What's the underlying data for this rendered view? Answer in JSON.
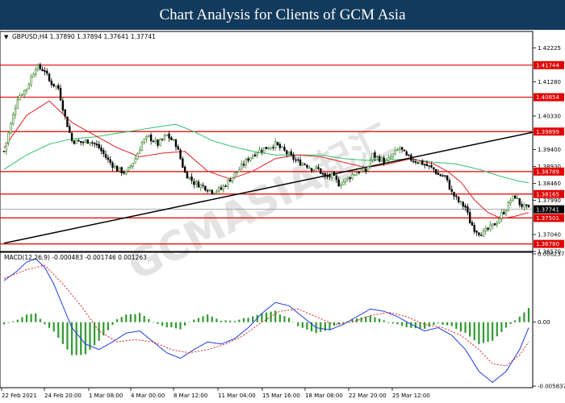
{
  "header": {
    "title": "Chart Analysis for Clients of GCM Asia"
  },
  "colors": {
    "header_bg": "#123a5c",
    "bull_candle": "#2f7d1e",
    "bear_candle": "#000000",
    "ma_fast": "#e02020",
    "ma_slow": "#30c070",
    "level_line": "#e00000",
    "trendline": "#000000",
    "macd_line": "#1f3fe0",
    "signal_line": "#e02020",
    "histogram": "#2f9a2f",
    "price_tag_bg": "#e00000",
    "current_tag_bg": "#000000"
  },
  "chart_data": [
    {
      "type": "candlestick",
      "symbol_info": "GBPUSD,H4  1.37890 1.37894 1.37641 1.37741",
      "ylim": [
        1.3657,
        1.4268
      ],
      "y_ticks": [
        "1.42225",
        "1.41280",
        "1.40330",
        "1.39400",
        "1.38930",
        "1.38460",
        "1.37990",
        "1.37040",
        "1.36570"
      ],
      "x_ticks": [
        "22 Feb 2021",
        "24 Feb 20:00",
        "1 Mar 08:00",
        "4 Mar 00:00",
        "8 Mar 12:00",
        "11 Mar 04:00",
        "15 Mar 16:00",
        "18 Mar 08:00",
        "22 Mar 20:00",
        "25 Mar 12:00"
      ],
      "current_price": "1.37741",
      "levels": [
        {
          "value": 1.41744,
          "label": "1.41744"
        },
        {
          "value": 1.40854,
          "label": "1.40854"
        },
        {
          "value": 1.39899,
          "label": "1.39899"
        },
        {
          "value": 1.38789,
          "label": "1.38789"
        },
        {
          "value": 1.38165,
          "label": "1.38165"
        },
        {
          "value": 1.37501,
          "label": "1.37501"
        },
        {
          "value": 1.3678,
          "label": "1.36780"
        }
      ],
      "trendline": {
        "start": [
          0,
          1.368
        ],
        "end": [
          140,
          1.3988
        ]
      },
      "anchors": [
        [
          0,
          1.3935
        ],
        [
          6,
          1.4085
        ],
        [
          10,
          1.411
        ],
        [
          14,
          1.417
        ],
        [
          18,
          1.416
        ],
        [
          20,
          1.413
        ],
        [
          24,
          1.411
        ],
        [
          27,
          1.403
        ],
        [
          30,
          1.3965
        ],
        [
          34,
          1.396
        ],
        [
          38,
          1.3965
        ],
        [
          42,
          1.3945
        ],
        [
          46,
          1.391
        ],
        [
          50,
          1.3885
        ],
        [
          54,
          1.3875
        ],
        [
          58,
          1.3915
        ],
        [
          61,
          1.396
        ],
        [
          64,
          1.3975
        ],
        [
          68,
          1.3955
        ],
        [
          72,
          1.398
        ],
        [
          76,
          1.3955
        ],
        [
          80,
          1.3875
        ],
        [
          84,
          1.3848
        ],
        [
          88,
          1.3838
        ],
        [
          92,
          1.3825
        ],
        [
          96,
          1.383
        ],
        [
          100,
          1.3858
        ],
        [
          104,
          1.3885
        ],
        [
          108,
          1.3915
        ],
        [
          112,
          1.3935
        ],
        [
          116,
          1.3945
        ],
        [
          120,
          1.3955
        ],
        [
          124,
          1.3935
        ],
        [
          127,
          1.392
        ],
        [
          130,
          1.3905
        ],
        [
          133,
          1.39
        ],
        [
          136,
          1.3888
        ],
        [
          139,
          1.3885
        ],
        [
          142,
          1.3862
        ],
        [
          145,
          1.3868
        ],
        [
          148,
          1.3845
        ],
        [
          151,
          1.3855
        ],
        [
          154,
          1.387
        ],
        [
          157,
          1.388
        ],
        [
          160,
          1.388
        ],
        [
          163,
          1.3925
        ],
        [
          166,
          1.3915
        ],
        [
          169,
          1.3905
        ],
        [
          172,
          1.3925
        ],
        [
          175,
          1.3945
        ],
        [
          178,
          1.392
        ],
        [
          181,
          1.391
        ],
        [
          184,
          1.3905
        ],
        [
          187,
          1.3895
        ],
        [
          190,
          1.3885
        ],
        [
          192,
          1.387
        ],
        [
          195,
          1.3865
        ],
        [
          198,
          1.382
        ],
        [
          201,
          1.3795
        ],
        [
          204,
          1.378
        ],
        [
          206,
          1.374
        ],
        [
          208,
          1.372
        ],
        [
          210,
          1.371
        ],
        [
          212,
          1.3708
        ],
        [
          214,
          1.3718
        ],
        [
          216,
          1.3728
        ],
        [
          218,
          1.374
        ],
        [
          220,
          1.376
        ],
        [
          222,
          1.3775
        ],
        [
          224,
          1.38
        ],
        [
          226,
          1.381
        ],
        [
          228,
          1.379
        ],
        [
          230,
          1.378
        ],
        [
          232,
          1.3774
        ]
      ],
      "ma_fast": [
        [
          0,
          1.3945
        ],
        [
          10,
          1.4035
        ],
        [
          20,
          1.4075
        ],
        [
          30,
          1.4015
        ],
        [
          40,
          1.398
        ],
        [
          50,
          1.3945
        ],
        [
          60,
          1.392
        ],
        [
          70,
          1.393
        ],
        [
          80,
          1.3935
        ],
        [
          90,
          1.388
        ],
        [
          100,
          1.3858
        ],
        [
          110,
          1.388
        ],
        [
          120,
          1.3915
        ],
        [
          130,
          1.3925
        ],
        [
          140,
          1.392
        ],
        [
          150,
          1.3905
        ],
        [
          160,
          1.389
        ],
        [
          170,
          1.39
        ],
        [
          180,
          1.3915
        ],
        [
          190,
          1.39
        ],
        [
          196,
          1.388
        ],
        [
          202,
          1.385
        ],
        [
          208,
          1.38
        ],
        [
          214,
          1.3765
        ],
        [
          220,
          1.3748
        ],
        [
          226,
          1.3755
        ],
        [
          232,
          1.3765
        ]
      ],
      "ma_slow": [
        [
          0,
          1.3885
        ],
        [
          10,
          1.3925
        ],
        [
          20,
          1.3955
        ],
        [
          30,
          1.397
        ],
        [
          40,
          1.3975
        ],
        [
          50,
          1.3985
        ],
        [
          60,
          1.3995
        ],
        [
          70,
          1.4005
        ],
        [
          76,
          1.401
        ],
        [
          84,
          1.399
        ],
        [
          92,
          1.3965
        ],
        [
          100,
          1.395
        ],
        [
          110,
          1.3935
        ],
        [
          120,
          1.3925
        ],
        [
          130,
          1.3925
        ],
        [
          140,
          1.3925
        ],
        [
          150,
          1.3915
        ],
        [
          160,
          1.391
        ],
        [
          170,
          1.3912
        ],
        [
          180,
          1.3913
        ],
        [
          190,
          1.3905
        ],
        [
          200,
          1.39
        ],
        [
          210,
          1.3885
        ],
        [
          220,
          1.3865
        ],
        [
          228,
          1.3852
        ],
        [
          232,
          1.3848
        ]
      ]
    },
    {
      "type": "macd",
      "title": "MACD(12,26,9) -0.000483 -0.001746 0.001263",
      "ylim": [
        -0.005837,
        0.006237
      ],
      "y_ticks": [
        "0.006237",
        "0.00",
        "-0.005837"
      ],
      "macd": [
        [
          0,
          0.0038
        ],
        [
          6,
          0.0047
        ],
        [
          10,
          0.0055
        ],
        [
          14,
          0.0058
        ],
        [
          18,
          0.005
        ],
        [
          22,
          0.0035
        ],
        [
          26,
          0.0015
        ],
        [
          30,
          -0.0005
        ],
        [
          36,
          -0.002
        ],
        [
          42,
          -0.0025
        ],
        [
          48,
          -0.0018
        ],
        [
          54,
          -0.001
        ],
        [
          60,
          -0.0008
        ],
        [
          66,
          -0.0018
        ],
        [
          72,
          -0.0028
        ],
        [
          78,
          -0.0033
        ],
        [
          84,
          -0.0025
        ],
        [
          90,
          -0.0018
        ],
        [
          96,
          -0.002
        ],
        [
          102,
          -0.0015
        ],
        [
          108,
          -0.0005
        ],
        [
          114,
          0.0008
        ],
        [
          120,
          0.0018
        ],
        [
          126,
          0.0015
        ],
        [
          132,
          0.0005
        ],
        [
          138,
          -0.0005
        ],
        [
          144,
          -0.0007
        ],
        [
          150,
          -0.0002
        ],
        [
          156,
          0.0005
        ],
        [
          162,
          0.0012
        ],
        [
          168,
          0.001
        ],
        [
          174,
          0.0005
        ],
        [
          180,
          -0.0002
        ],
        [
          186,
          -0.0008
        ],
        [
          192,
          -0.0005
        ],
        [
          198,
          -0.0012
        ],
        [
          204,
          -0.0025
        ],
        [
          210,
          -0.0045
        ],
        [
          216,
          -0.0055
        ],
        [
          222,
          -0.0045
        ],
        [
          228,
          -0.0025
        ],
        [
          232,
          -0.0005
        ]
      ],
      "signal": [
        [
          0,
          0.004
        ],
        [
          10,
          0.0048
        ],
        [
          18,
          0.0052
        ],
        [
          26,
          0.0035
        ],
        [
          34,
          0.0015
        ],
        [
          42,
          -0.0008
        ],
        [
          50,
          -0.0018
        ],
        [
          58,
          -0.0016
        ],
        [
          66,
          -0.0018
        ],
        [
          74,
          -0.0025
        ],
        [
          82,
          -0.0028
        ],
        [
          90,
          -0.0025
        ],
        [
          98,
          -0.002
        ],
        [
          106,
          -0.0012
        ],
        [
          114,
          0.0
        ],
        [
          122,
          0.001
        ],
        [
          130,
          0.0012
        ],
        [
          138,
          0.0005
        ],
        [
          146,
          -0.0002
        ],
        [
          154,
          0.0
        ],
        [
          162,
          0.0006
        ],
        [
          170,
          0.0009
        ],
        [
          178,
          0.0005
        ],
        [
          186,
          -0.0002
        ],
        [
          194,
          -0.0005
        ],
        [
          202,
          -0.0012
        ],
        [
          210,
          -0.0025
        ],
        [
          216,
          -0.0038
        ],
        [
          222,
          -0.004
        ],
        [
          228,
          -0.003
        ],
        [
          232,
          -0.0018
        ]
      ]
    }
  ]
}
